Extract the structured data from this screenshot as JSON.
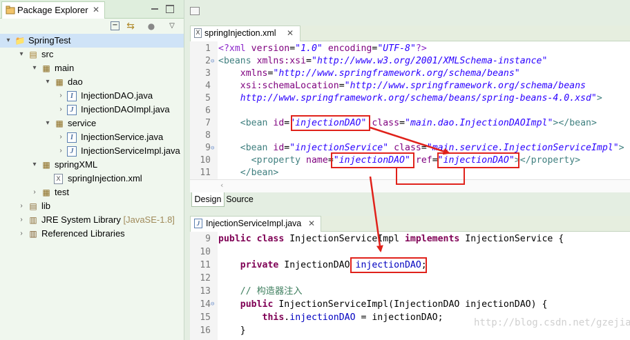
{
  "explorer": {
    "tab_title": "Package Explorer",
    "tree": [
      {
        "label": "SpringTest",
        "icon": "project-icon",
        "twisty": "▾",
        "depth": 0
      },
      {
        "label": "src",
        "icon": "source-folder-icon",
        "twisty": "▾",
        "depth": 1
      },
      {
        "label": "main",
        "icon": "package-icon",
        "twisty": "▾",
        "depth": 2
      },
      {
        "label": "dao",
        "icon": "package-icon",
        "twisty": "▾",
        "depth": 3
      },
      {
        "label": "InjectionDAO.java",
        "icon": "java-interface-icon",
        "twisty": "›",
        "depth": 4
      },
      {
        "label": "InjectionDAOImpl.java",
        "icon": "java-class-icon",
        "twisty": "›",
        "depth": 4
      },
      {
        "label": "service",
        "icon": "package-icon",
        "twisty": "▾",
        "depth": 3
      },
      {
        "label": "InjectionService.java",
        "icon": "java-interface-icon",
        "twisty": "›",
        "depth": 4
      },
      {
        "label": "InjectionServiceImpl.java",
        "icon": "java-class-icon",
        "twisty": "›",
        "depth": 4
      },
      {
        "label": "springXML",
        "icon": "package-icon",
        "twisty": "▾",
        "depth": 2
      },
      {
        "label": "springInjection.xml",
        "icon": "xml-file-icon",
        "twisty": "",
        "depth": 3
      },
      {
        "label": "test",
        "icon": "package-icon",
        "twisty": "›",
        "depth": 2
      },
      {
        "label": "lib",
        "icon": "folder-icon",
        "twisty": "›",
        "depth": 1
      },
      {
        "label": "JRE System Library",
        "suffix": "[JavaSE-1.8]",
        "icon": "library-icon",
        "twisty": "›",
        "depth": 1
      },
      {
        "label": "Referenced Libraries",
        "icon": "jar-library-icon",
        "twisty": "›",
        "depth": 1
      }
    ]
  },
  "xml_editor": {
    "tab_title": "springInjection.xml",
    "bottom_tabs": [
      "Design",
      "Source"
    ],
    "lines": [
      {
        "n": "1",
        "fold": "",
        "parts": [
          [
            "pi",
            "<?xml "
          ],
          [
            "attr",
            "version"
          ],
          [
            "plain",
            "="
          ],
          [
            "str",
            "\"1.0\""
          ],
          [
            "plain",
            " "
          ],
          [
            "attr",
            "encoding"
          ],
          [
            "plain",
            "="
          ],
          [
            "str",
            "\"UTF-8\""
          ],
          [
            "pi",
            "?>"
          ]
        ]
      },
      {
        "n": "2",
        "fold": "⊖",
        "parts": [
          [
            "tag",
            "<beans "
          ],
          [
            "attr",
            "xmlns:xsi"
          ],
          [
            "plain",
            "="
          ],
          [
            "str",
            "\"http://www.w3.org/2001/XMLSchema-instance\""
          ]
        ]
      },
      {
        "n": "3",
        "fold": "",
        "parts": [
          [
            "plain",
            "    "
          ],
          [
            "attr",
            "xmlns"
          ],
          [
            "plain",
            "="
          ],
          [
            "str",
            "\"http://www.springframework.org/schema/beans\""
          ]
        ]
      },
      {
        "n": "4",
        "fold": "",
        "parts": [
          [
            "plain",
            "    "
          ],
          [
            "attr",
            "xsi:schemaLocation"
          ],
          [
            "plain",
            "="
          ],
          [
            "str",
            "\"http://www.springframework.org/schema/beans"
          ]
        ]
      },
      {
        "n": "5",
        "fold": "",
        "parts": [
          [
            "plain",
            "    "
          ],
          [
            "str",
            "http://www.springframework.org/schema/beans/spring-beans-4.0.xsd\""
          ],
          [
            "tag",
            ">"
          ]
        ]
      },
      {
        "n": "6",
        "fold": "",
        "parts": []
      },
      {
        "n": "7",
        "fold": "",
        "parts": [
          [
            "plain",
            "    "
          ],
          [
            "tag",
            "<bean "
          ],
          [
            "attr",
            "id"
          ],
          [
            "plain",
            "="
          ],
          [
            "str",
            "\"injectionDAO\""
          ],
          [
            "plain",
            " "
          ],
          [
            "attr",
            "class"
          ],
          [
            "plain",
            "="
          ],
          [
            "str",
            "\"main.dao.InjectionDAOImpl\""
          ],
          [
            "tag",
            "></bean>"
          ]
        ]
      },
      {
        "n": "8",
        "fold": "",
        "parts": []
      },
      {
        "n": "9",
        "fold": "⊖",
        "parts": [
          [
            "plain",
            "    "
          ],
          [
            "tag",
            "<bean "
          ],
          [
            "attr",
            "id"
          ],
          [
            "plain",
            "="
          ],
          [
            "str",
            "\"injectionService\""
          ],
          [
            "plain",
            " "
          ],
          [
            "attr",
            "class"
          ],
          [
            "plain",
            "="
          ],
          [
            "str",
            "\"main.service.InjectionServiceImpl\""
          ],
          [
            "tag",
            ">"
          ]
        ]
      },
      {
        "n": "10",
        "fold": "",
        "parts": [
          [
            "plain",
            "      "
          ],
          [
            "tag",
            "<property "
          ],
          [
            "attr",
            "name"
          ],
          [
            "plain",
            "="
          ],
          [
            "str",
            "\"injectionDAO\""
          ],
          [
            "plain",
            " "
          ],
          [
            "attr",
            "ref"
          ],
          [
            "plain",
            "="
          ],
          [
            "str",
            "\"injectionDAO\""
          ],
          [
            "tag",
            "></property>"
          ]
        ]
      },
      {
        "n": "11",
        "fold": "",
        "parts": [
          [
            "plain",
            "    "
          ],
          [
            "tag",
            "</bean>"
          ]
        ]
      }
    ]
  },
  "java_editor": {
    "tab_title": "InjectionServiceImpl.java",
    "lines": [
      {
        "n": "9",
        "fold": "",
        "parts": [
          [
            "kw",
            "public class"
          ],
          [
            "plain",
            " InjectionServiceImpl "
          ],
          [
            "kw",
            "implements"
          ],
          [
            "plain",
            " InjectionService {"
          ]
        ]
      },
      {
        "n": "10",
        "fold": "",
        "parts": []
      },
      {
        "n": "11",
        "fold": "",
        "parts": [
          [
            "plain",
            "    "
          ],
          [
            "kw",
            "private"
          ],
          [
            "plain",
            " InjectionDAO "
          ],
          [
            "fld",
            "injectionDAO"
          ],
          [
            "plain",
            ";"
          ]
        ]
      },
      {
        "n": "12",
        "fold": "",
        "parts": []
      },
      {
        "n": "13",
        "fold": "",
        "parts": [
          [
            "plain",
            "    "
          ],
          [
            "cmt",
            "// 构造器注入"
          ]
        ]
      },
      {
        "n": "14",
        "fold": "⊖",
        "parts": [
          [
            "plain",
            "    "
          ],
          [
            "kw",
            "public"
          ],
          [
            "plain",
            " InjectionServiceImpl(InjectionDAO "
          ],
          [
            "plain",
            "injectionDAO) {"
          ]
        ]
      },
      {
        "n": "15",
        "fold": "",
        "parts": [
          [
            "plain",
            "        "
          ],
          [
            "kw",
            "this"
          ],
          [
            "plain",
            "."
          ],
          [
            "fld",
            "injectionDAO"
          ],
          [
            "plain",
            " = injectionDAO;"
          ]
        ]
      },
      {
        "n": "16",
        "fold": "",
        "parts": [
          [
            "plain",
            "    }"
          ]
        ]
      }
    ]
  },
  "watermark": "http://blog.csdn.net/gzejia",
  "colors": {
    "annotation": "#e0211a",
    "explorer_bg": "#f0f7ee",
    "editor_frame": "#e4eee2"
  }
}
